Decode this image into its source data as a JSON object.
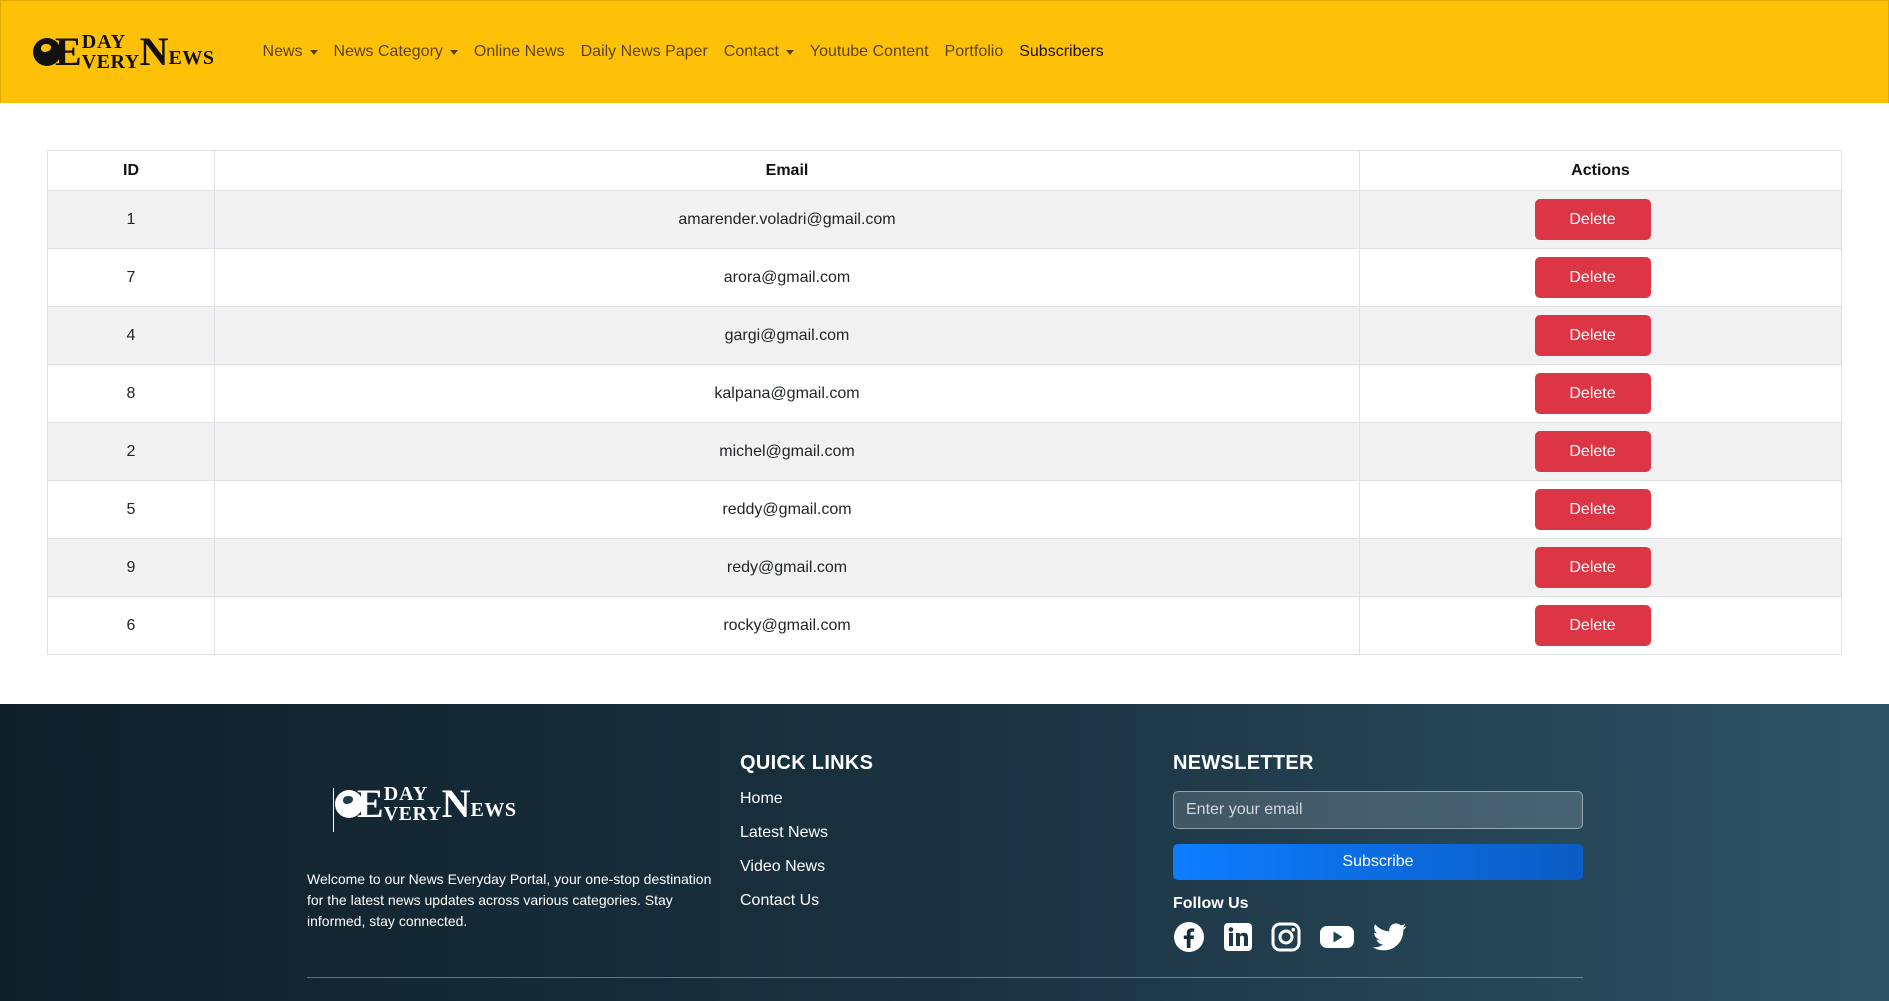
{
  "brand": {
    "logo_e": "E",
    "logo_day": "DAY",
    "logo_very": "VERY",
    "logo_n": "N",
    "logo_ews": "EWS"
  },
  "nav": {
    "items": [
      {
        "label": "News",
        "dropdown": true
      },
      {
        "label": "News Category",
        "dropdown": true
      },
      {
        "label": "Online News",
        "dropdown": false
      },
      {
        "label": "Daily News Paper",
        "dropdown": false
      },
      {
        "label": "Contact",
        "dropdown": true
      },
      {
        "label": "Youtube Content",
        "dropdown": false
      },
      {
        "label": "Portfolio",
        "dropdown": false
      },
      {
        "label": "Subscribers",
        "dropdown": false,
        "active": true
      }
    ]
  },
  "table": {
    "headers": {
      "id": "ID",
      "email": "Email",
      "actions": "Actions"
    },
    "delete_label": "Delete",
    "rows": [
      {
        "id": "1",
        "email": "amarender.voladri@gmail.com"
      },
      {
        "id": "7",
        "email": "arora@gmail.com"
      },
      {
        "id": "4",
        "email": "gargi@gmail.com"
      },
      {
        "id": "8",
        "email": "kalpana@gmail.com"
      },
      {
        "id": "2",
        "email": "michel@gmail.com"
      },
      {
        "id": "5",
        "email": "reddy@gmail.com"
      },
      {
        "id": "9",
        "email": "redy@gmail.com"
      },
      {
        "id": "6",
        "email": "rocky@gmail.com"
      }
    ]
  },
  "footer": {
    "description": "Welcome to our News Everyday Portal, your one-stop destination for the latest news updates across various categories. Stay informed, stay connected.",
    "quick_links": {
      "title": "QUICK LINKS",
      "items": [
        "Home",
        "Latest News",
        "Video News",
        "Contact Us"
      ]
    },
    "newsletter": {
      "title": "NEWSLETTER",
      "placeholder": "Enter your email",
      "button": "Subscribe",
      "follow_label": "Follow Us",
      "social_icons": [
        "facebook-icon",
        "linkedin-icon",
        "instagram-icon",
        "youtube-icon",
        "twitter-icon"
      ]
    }
  },
  "colors": {
    "navbar": "#ffc107",
    "delete_button": "#dc3545",
    "subscribe_button": "#0d7dff",
    "footer_dark": "#0f1f2a",
    "footer_light": "#2e5366"
  }
}
